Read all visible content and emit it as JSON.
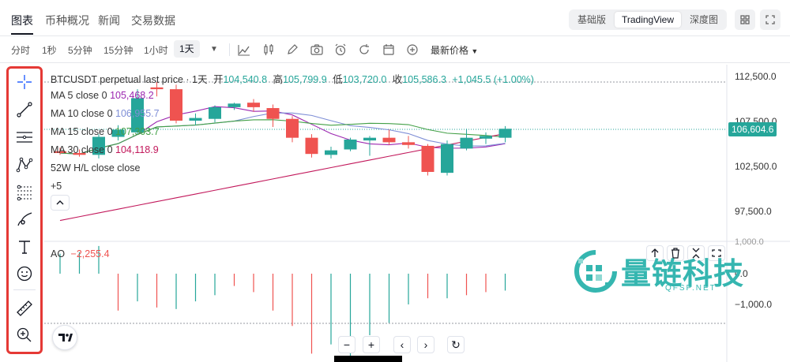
{
  "topnav": {
    "tabs": [
      "图表",
      "币种概况",
      "新闻",
      "交易数据"
    ],
    "views": [
      "基础版",
      "TradingView",
      "深度图"
    ],
    "active_view": "TradingView"
  },
  "toolbar": {
    "timeframes": [
      "分时",
      "1秒",
      "5分钟",
      "15分钟",
      "1小时",
      "1天"
    ],
    "active_timeframe": "1天",
    "price_type": "最新价格"
  },
  "drawing_tools": [
    "crosshair",
    "trend-line",
    "horizontal-lines",
    "pattern",
    "fib-levels",
    "brush",
    "text",
    "emoji",
    "measure",
    "zoom-in"
  ],
  "chart": {
    "title": "BTCUSDT perpetual last price · 1天",
    "ohlc": {
      "open_label": "开",
      "open": "104,540.8",
      "high_label": "高",
      "high": "105,799.9",
      "low_label": "低",
      "low": "103,720.0",
      "close_label": "收",
      "close": "105,586.3",
      "change": "+1,045.5 (+1.00%)"
    },
    "indicators": [
      {
        "label": "MA 5 close 0",
        "value": "105,468.2",
        "color": "#9c27b0"
      },
      {
        "label": "MA 10 close 0",
        "value": "106,955.7",
        "color": "#7e8ed6"
      },
      {
        "label": "MA 15 close 0",
        "value": "107,303.7",
        "color": "#43a047"
      },
      {
        "label": "MA 30 close 0",
        "value": "104,118.9",
        "color": "#c2185b"
      }
    ],
    "hl_label": "52W H/L close close",
    "more_label": "+5",
    "price_axis": [
      "112,500.0",
      "107,500.0",
      "102,500.0",
      "97,500.0"
    ],
    "last_price": "106,604.6",
    "ao": {
      "label": "AO",
      "value": "−2,255.4",
      "axis": [
        "1,000.0",
        "0.0",
        "−1,000.0"
      ]
    },
    "colors": {
      "up": "#26a69a",
      "down": "#ef5350"
    },
    "candles": [
      {
        "o": 104100,
        "h": 104500,
        "l": 103700,
        "c": 103900
      },
      {
        "o": 103900,
        "h": 104300,
        "l": 103500,
        "c": 103700
      },
      {
        "o": 103700,
        "h": 106000,
        "l": 103300,
        "c": 105700
      },
      {
        "o": 105700,
        "h": 107000,
        "l": 105300,
        "c": 106500
      },
      {
        "o": 106200,
        "h": 111000,
        "l": 106000,
        "c": 110000
      },
      {
        "o": 111200,
        "h": 111800,
        "l": 110200,
        "c": 111000
      },
      {
        "o": 111000,
        "h": 111500,
        "l": 107200,
        "c": 107500
      },
      {
        "o": 107500,
        "h": 108300,
        "l": 107000,
        "c": 107800
      },
      {
        "o": 107700,
        "h": 109200,
        "l": 107300,
        "c": 109000
      },
      {
        "o": 109000,
        "h": 109500,
        "l": 108700,
        "c": 109400
      },
      {
        "o": 109500,
        "h": 109900,
        "l": 108500,
        "c": 109000
      },
      {
        "o": 108900,
        "h": 109300,
        "l": 106800,
        "c": 107700
      },
      {
        "o": 107700,
        "h": 108000,
        "l": 105100,
        "c": 105600
      },
      {
        "o": 105600,
        "h": 106000,
        "l": 103400,
        "c": 103800
      },
      {
        "o": 103700,
        "h": 104600,
        "l": 103300,
        "c": 104200
      },
      {
        "o": 104300,
        "h": 105600,
        "l": 104100,
        "c": 105400
      },
      {
        "o": 105300,
        "h": 105800,
        "l": 103600,
        "c": 105600
      },
      {
        "o": 105600,
        "h": 106500,
        "l": 104800,
        "c": 105100
      },
      {
        "o": 105100,
        "h": 105800,
        "l": 104400,
        "c": 104800
      },
      {
        "o": 104700,
        "h": 104900,
        "l": 101400,
        "c": 101800
      },
      {
        "o": 101700,
        "h": 105300,
        "l": 101400,
        "c": 104900
      },
      {
        "o": 104400,
        "h": 106600,
        "l": 104200,
        "c": 105600
      },
      {
        "o": 105500,
        "h": 106200,
        "l": 104900,
        "c": 105800
      },
      {
        "o": 105600,
        "h": 106900,
        "l": 105100,
        "c": 106600
      }
    ],
    "ao_bars": [
      {
        "v": 650,
        "c": "up"
      },
      {
        "v": 700,
        "c": "up"
      },
      {
        "v": 900,
        "c": "up"
      },
      {
        "v": -1200,
        "c": "down"
      },
      {
        "v": -900,
        "c": "up"
      },
      {
        "v": -1100,
        "c": "down"
      },
      {
        "v": -1150,
        "c": "up"
      },
      {
        "v": -900,
        "c": "up"
      },
      {
        "v": -700,
        "c": "up"
      },
      {
        "v": -400,
        "c": "down"
      },
      {
        "v": -600,
        "c": "down"
      },
      {
        "v": -1200,
        "c": "down"
      },
      {
        "v": -1700,
        "c": "down"
      },
      {
        "v": -2600,
        "c": "down"
      },
      {
        "v": -2300,
        "c": "up"
      },
      {
        "v": -2700,
        "c": "up"
      },
      {
        "v": -2000,
        "c": "up"
      },
      {
        "v": -1600,
        "c": "up"
      },
      {
        "v": -1000,
        "c": "up"
      },
      {
        "v": -800,
        "c": "down"
      },
      {
        "v": -800,
        "c": "up"
      },
      {
        "v": -700,
        "c": "down"
      },
      {
        "v": -600,
        "c": "down"
      },
      {
        "v": -550,
        "c": "up"
      }
    ],
    "nav_buttons": [
      "−",
      "+",
      "‹",
      "›",
      "↻"
    ]
  },
  "watermark": {
    "name": "量链科技",
    "sub": "QFSP.NET"
  }
}
